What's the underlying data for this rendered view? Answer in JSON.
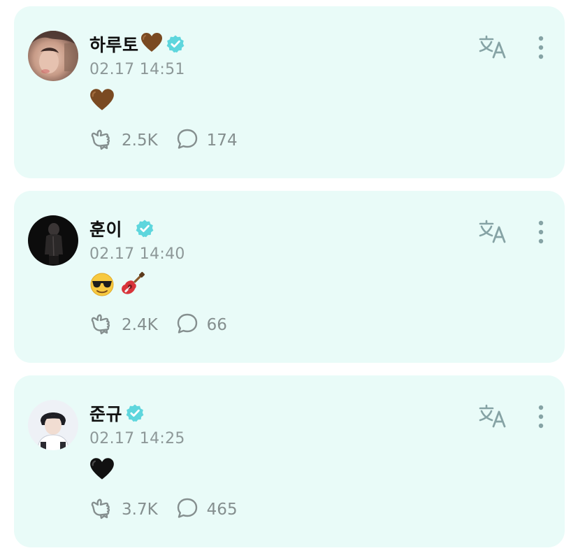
{
  "posts": [
    {
      "author": "하루토",
      "name_emoji": "brown-heart",
      "verified": true,
      "timestamp": "02.17 14:51",
      "content_emojis": [
        "brown-heart"
      ],
      "likes": "2.5K",
      "comments": "174"
    },
    {
      "author": "훈이",
      "name_emoji": null,
      "verified": true,
      "timestamp": "02.17 14:40",
      "content_emojis": [
        "sunglasses-face",
        "guitar"
      ],
      "likes": "2.4K",
      "comments": "66"
    },
    {
      "author": "준규",
      "name_emoji": null,
      "verified": true,
      "timestamp": "02.17 14:25",
      "content_emojis": [
        "black-heart"
      ],
      "likes": "3.7K",
      "comments": "465"
    }
  ],
  "icons": {
    "like": "like-hand-icon",
    "comment": "comment-bubble-icon",
    "translate": "translate-icon",
    "more": "more-vertical-icon",
    "verified": "verified-badge-icon"
  },
  "colors": {
    "card_background": "#e9fbf8",
    "verified_badge": "#5ed6dd",
    "secondary_text": "#8d9898",
    "brown_heart": "#7a4a22",
    "black_heart": "#111111"
  }
}
